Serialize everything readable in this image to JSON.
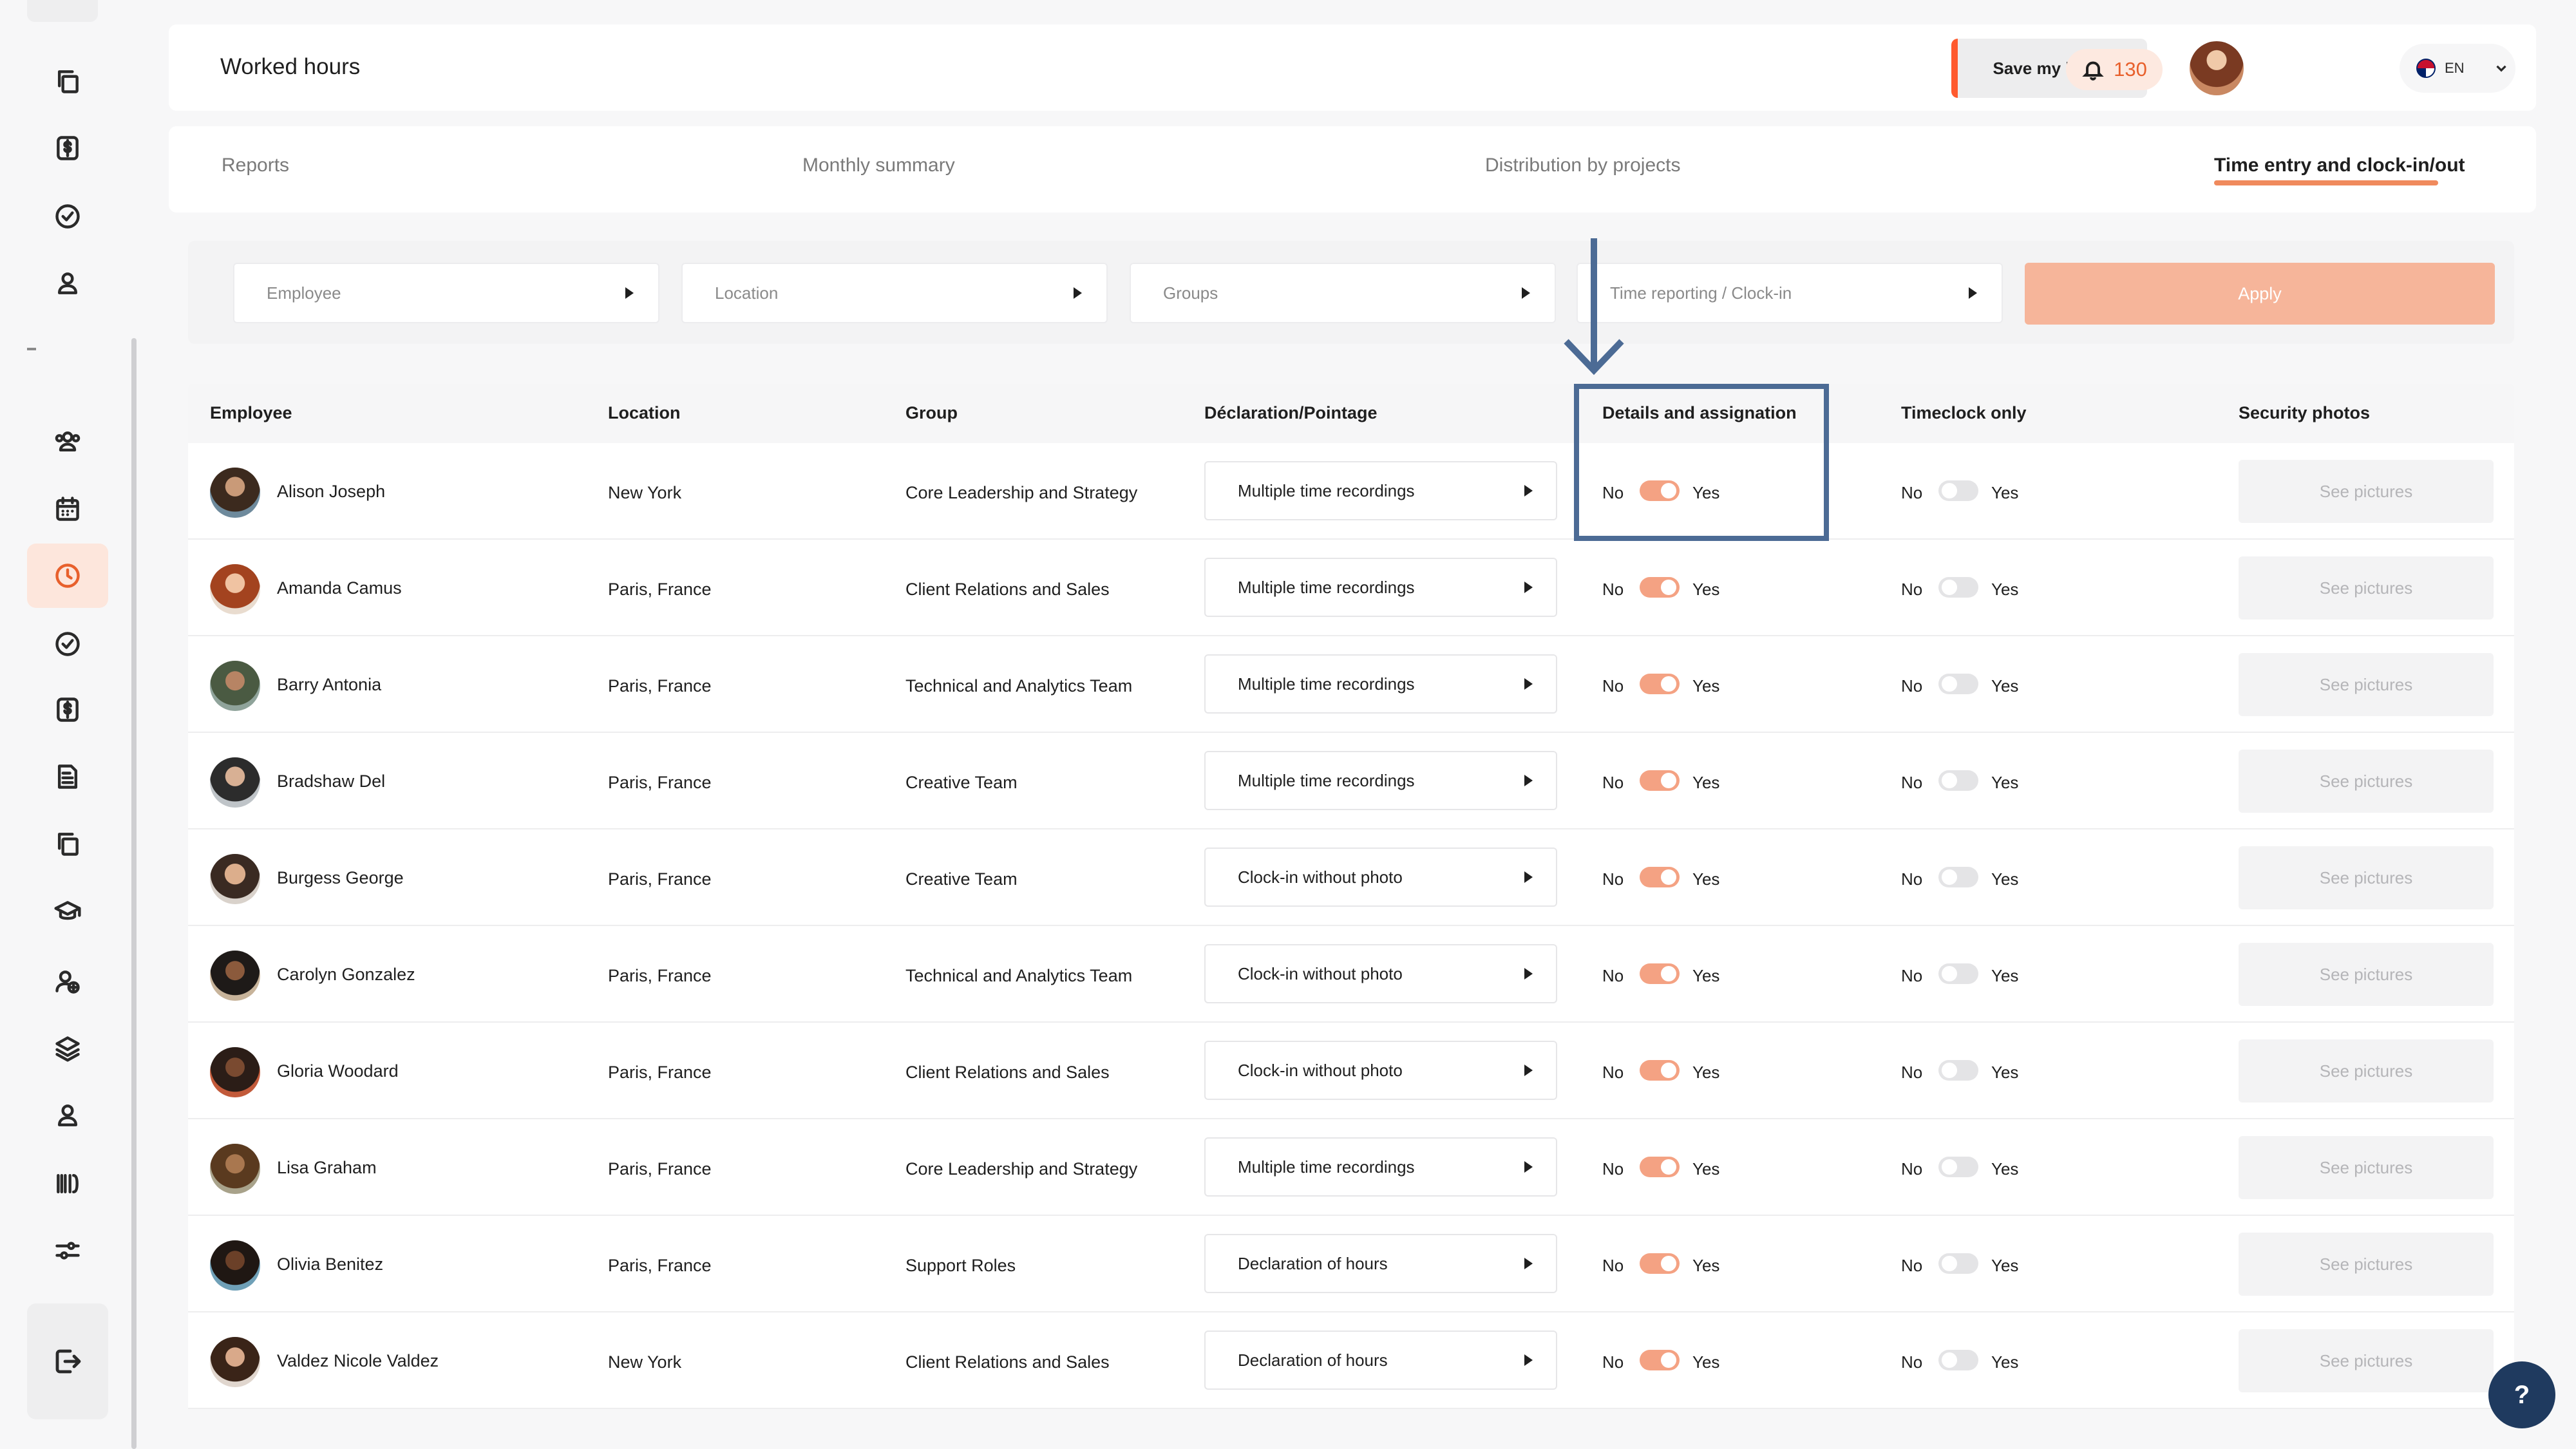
{
  "header": {
    "title": "Worked hours",
    "save_label": "Save my hours",
    "notification_count": "130",
    "language": "EN"
  },
  "sidebar": {
    "icons": [
      "copy-icon",
      "dollar-icon",
      "check-circle-icon",
      "user-icon",
      "team-icon",
      "calendar-icon",
      "clock-icon",
      "check-circle-icon",
      "dollar-icon",
      "report-icon",
      "copy-icon",
      "graduation-icon",
      "user-add-icon",
      "layers-icon",
      "user-icon",
      "barcode-icon",
      "sliders-icon",
      "logout-icon"
    ],
    "active": "clock-icon"
  },
  "tabs": [
    {
      "label": "Reports",
      "active": false
    },
    {
      "label": "Monthly summary",
      "active": false
    },
    {
      "label": "Distribution by projects",
      "active": false
    },
    {
      "label": "Time entry and clock-in/out",
      "active": true
    }
  ],
  "filters": {
    "employee": "Employee",
    "location": "Location",
    "groups": "Groups",
    "time_reporting": "Time reporting / Clock-in",
    "apply": "Apply"
  },
  "table": {
    "headers": [
      "Employee",
      "Location",
      "Group",
      "Déclaration/Pointage",
      "Details and assignation",
      "Timeclock only",
      "Security photos"
    ],
    "toggle_no": "No",
    "toggle_yes": "Yes",
    "see_pictures": "See pictures",
    "rows": [
      {
        "name": "Alison Joseph",
        "location": "New York",
        "group": "Core Leadership and Strategy",
        "declaration": "Multiple time recordings",
        "details_on": true,
        "timeclock_on": false
      },
      {
        "name": "Amanda Camus",
        "location": "Paris, France",
        "group": "Client Relations and Sales",
        "declaration": "Multiple time recordings",
        "details_on": true,
        "timeclock_on": false
      },
      {
        "name": "Barry Antonia",
        "location": "Paris, France",
        "group": "Technical and Analytics Team",
        "declaration": "Multiple time recordings",
        "details_on": true,
        "timeclock_on": false
      },
      {
        "name": "Bradshaw Del",
        "location": "Paris, France",
        "group": "Creative Team",
        "declaration": "Multiple time recordings",
        "details_on": true,
        "timeclock_on": false
      },
      {
        "name": "Burgess George",
        "location": "Paris, France",
        "group": "Creative Team",
        "declaration": "Clock-in without photo",
        "details_on": true,
        "timeclock_on": false
      },
      {
        "name": "Carolyn Gonzalez",
        "location": "Paris, France",
        "group": "Technical and Analytics Team",
        "declaration": "Clock-in without photo",
        "details_on": true,
        "timeclock_on": false
      },
      {
        "name": "Gloria Woodard",
        "location": "Paris, France",
        "group": "Client Relations and Sales",
        "declaration": "Clock-in without photo",
        "details_on": true,
        "timeclock_on": false
      },
      {
        "name": "Lisa Graham",
        "location": "Paris, France",
        "group": "Core Leadership and Strategy",
        "declaration": "Multiple time recordings",
        "details_on": true,
        "timeclock_on": false
      },
      {
        "name": "Olivia Benitez",
        "location": "Paris, France",
        "group": "Support Roles",
        "declaration": "Declaration of hours",
        "details_on": true,
        "timeclock_on": false
      },
      {
        "name": "Valdez Nicole Valdez",
        "location": "New York",
        "group": "Client Relations and Sales",
        "declaration": "Declaration of hours",
        "details_on": true,
        "timeclock_on": false
      }
    ]
  },
  "help": "?",
  "colors": {
    "accent": "#e8602c",
    "toggle_on": "#f4a283",
    "highlight": "#4c6b95"
  }
}
